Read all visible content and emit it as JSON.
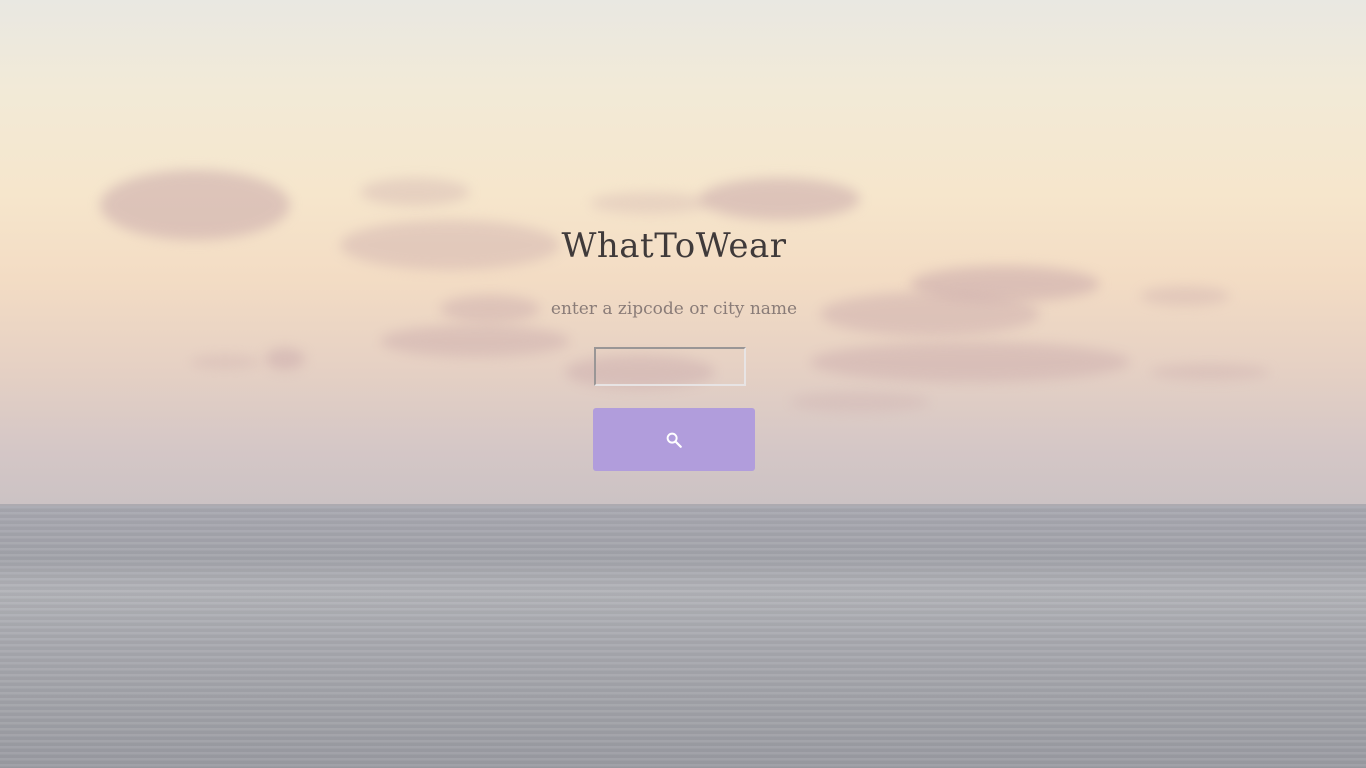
{
  "app": {
    "title": "WhatToWear",
    "subtitle": "enter a zipcode or city name"
  },
  "search": {
    "value": "",
    "placeholder": "",
    "button_icon": "search-icon"
  },
  "colors": {
    "button": "#b19ddc",
    "title_text": "#3f3a3a",
    "subtitle_text": "#8a7c78"
  }
}
